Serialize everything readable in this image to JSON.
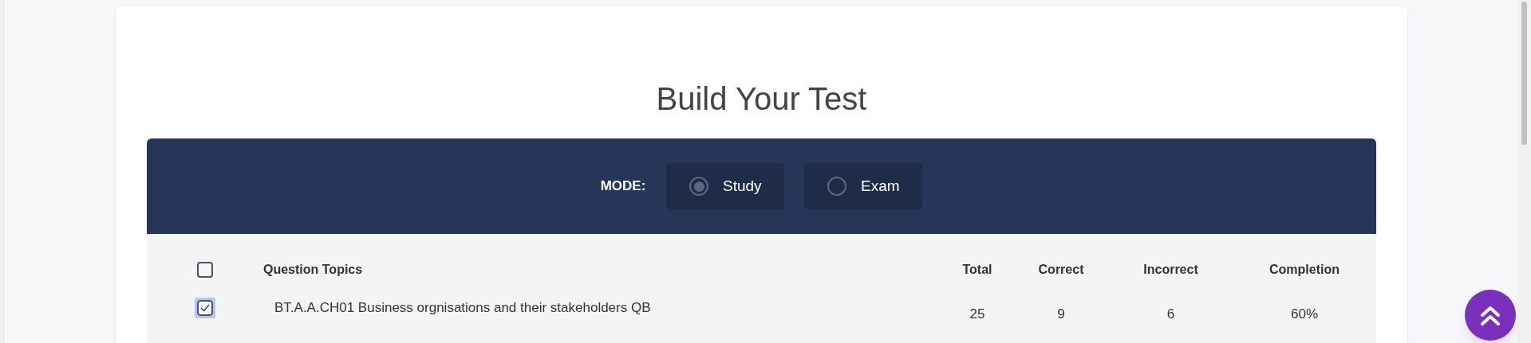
{
  "title": "Build Your Test",
  "mode": {
    "label": "MODE:",
    "options": [
      {
        "label": "Study",
        "selected": true
      },
      {
        "label": "Exam",
        "selected": false
      }
    ]
  },
  "table": {
    "select_all": {
      "checked": false
    },
    "columns": [
      "Question Topics",
      "Total",
      "Correct",
      "Incorrect",
      "Completion"
    ],
    "rows": [
      {
        "checked": true,
        "cells": [
          "BT.A.A.CH01 Business orgnisations and their stakeholders QB",
          "25",
          "9",
          "6",
          "60%"
        ]
      }
    ]
  }
}
